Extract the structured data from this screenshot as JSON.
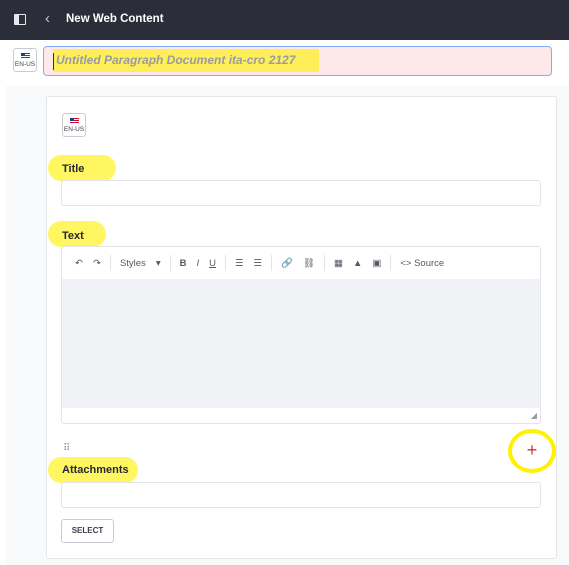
{
  "header": {
    "title": "New Web Content",
    "icons": [
      "sidebar-toggle-icon",
      "chevron-left-icon"
    ]
  },
  "locale": {
    "code": "EN-US",
    "flag": "us-flag-icon"
  },
  "document_title": {
    "placeholder": "Untitled Paragraph Document ita-cro 2127"
  },
  "form": {
    "locale_code": "EN-US",
    "title_label": "Title",
    "title_value": "",
    "text_label": "Text",
    "toolbar": {
      "undo": "undo-icon",
      "redo": "redo-icon",
      "styles_label": "Styles",
      "bold": "B",
      "italic": "I",
      "underline": "U",
      "source_label": "Source"
    },
    "attachments_label": "Attachments",
    "attachments_value": "",
    "select_label": "SELECT",
    "add_label": "+"
  },
  "colors": {
    "topbar": "#2b2d38",
    "highlight": "#fff200",
    "title_input_bg": "#fde9e9",
    "title_input_border": "#80acff",
    "add_button": "#d0333b"
  }
}
